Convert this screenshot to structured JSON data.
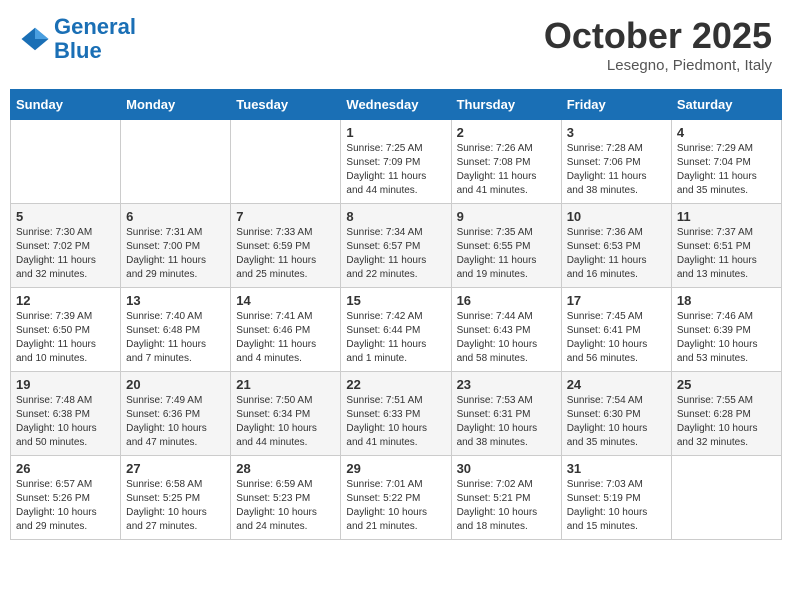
{
  "header": {
    "logo_line1": "General",
    "logo_line2": "Blue",
    "month": "October 2025",
    "location": "Lesegno, Piedmont, Italy"
  },
  "weekdays": [
    "Sunday",
    "Monday",
    "Tuesday",
    "Wednesday",
    "Thursday",
    "Friday",
    "Saturday"
  ],
  "weeks": [
    [
      {
        "day": "",
        "info": ""
      },
      {
        "day": "",
        "info": ""
      },
      {
        "day": "",
        "info": ""
      },
      {
        "day": "1",
        "info": "Sunrise: 7:25 AM\nSunset: 7:09 PM\nDaylight: 11 hours\nand 44 minutes."
      },
      {
        "day": "2",
        "info": "Sunrise: 7:26 AM\nSunset: 7:08 PM\nDaylight: 11 hours\nand 41 minutes."
      },
      {
        "day": "3",
        "info": "Sunrise: 7:28 AM\nSunset: 7:06 PM\nDaylight: 11 hours\nand 38 minutes."
      },
      {
        "day": "4",
        "info": "Sunrise: 7:29 AM\nSunset: 7:04 PM\nDaylight: 11 hours\nand 35 minutes."
      }
    ],
    [
      {
        "day": "5",
        "info": "Sunrise: 7:30 AM\nSunset: 7:02 PM\nDaylight: 11 hours\nand 32 minutes."
      },
      {
        "day": "6",
        "info": "Sunrise: 7:31 AM\nSunset: 7:00 PM\nDaylight: 11 hours\nand 29 minutes."
      },
      {
        "day": "7",
        "info": "Sunrise: 7:33 AM\nSunset: 6:59 PM\nDaylight: 11 hours\nand 25 minutes."
      },
      {
        "day": "8",
        "info": "Sunrise: 7:34 AM\nSunset: 6:57 PM\nDaylight: 11 hours\nand 22 minutes."
      },
      {
        "day": "9",
        "info": "Sunrise: 7:35 AM\nSunset: 6:55 PM\nDaylight: 11 hours\nand 19 minutes."
      },
      {
        "day": "10",
        "info": "Sunrise: 7:36 AM\nSunset: 6:53 PM\nDaylight: 11 hours\nand 16 minutes."
      },
      {
        "day": "11",
        "info": "Sunrise: 7:37 AM\nSunset: 6:51 PM\nDaylight: 11 hours\nand 13 minutes."
      }
    ],
    [
      {
        "day": "12",
        "info": "Sunrise: 7:39 AM\nSunset: 6:50 PM\nDaylight: 11 hours\nand 10 minutes."
      },
      {
        "day": "13",
        "info": "Sunrise: 7:40 AM\nSunset: 6:48 PM\nDaylight: 11 hours\nand 7 minutes."
      },
      {
        "day": "14",
        "info": "Sunrise: 7:41 AM\nSunset: 6:46 PM\nDaylight: 11 hours\nand 4 minutes."
      },
      {
        "day": "15",
        "info": "Sunrise: 7:42 AM\nSunset: 6:44 PM\nDaylight: 11 hours\nand 1 minute."
      },
      {
        "day": "16",
        "info": "Sunrise: 7:44 AM\nSunset: 6:43 PM\nDaylight: 10 hours\nand 58 minutes."
      },
      {
        "day": "17",
        "info": "Sunrise: 7:45 AM\nSunset: 6:41 PM\nDaylight: 10 hours\nand 56 minutes."
      },
      {
        "day": "18",
        "info": "Sunrise: 7:46 AM\nSunset: 6:39 PM\nDaylight: 10 hours\nand 53 minutes."
      }
    ],
    [
      {
        "day": "19",
        "info": "Sunrise: 7:48 AM\nSunset: 6:38 PM\nDaylight: 10 hours\nand 50 minutes."
      },
      {
        "day": "20",
        "info": "Sunrise: 7:49 AM\nSunset: 6:36 PM\nDaylight: 10 hours\nand 47 minutes."
      },
      {
        "day": "21",
        "info": "Sunrise: 7:50 AM\nSunset: 6:34 PM\nDaylight: 10 hours\nand 44 minutes."
      },
      {
        "day": "22",
        "info": "Sunrise: 7:51 AM\nSunset: 6:33 PM\nDaylight: 10 hours\nand 41 minutes."
      },
      {
        "day": "23",
        "info": "Sunrise: 7:53 AM\nSunset: 6:31 PM\nDaylight: 10 hours\nand 38 minutes."
      },
      {
        "day": "24",
        "info": "Sunrise: 7:54 AM\nSunset: 6:30 PM\nDaylight: 10 hours\nand 35 minutes."
      },
      {
        "day": "25",
        "info": "Sunrise: 7:55 AM\nSunset: 6:28 PM\nDaylight: 10 hours\nand 32 minutes."
      }
    ],
    [
      {
        "day": "26",
        "info": "Sunrise: 6:57 AM\nSunset: 5:26 PM\nDaylight: 10 hours\nand 29 minutes."
      },
      {
        "day": "27",
        "info": "Sunrise: 6:58 AM\nSunset: 5:25 PM\nDaylight: 10 hours\nand 27 minutes."
      },
      {
        "day": "28",
        "info": "Sunrise: 6:59 AM\nSunset: 5:23 PM\nDaylight: 10 hours\nand 24 minutes."
      },
      {
        "day": "29",
        "info": "Sunrise: 7:01 AM\nSunset: 5:22 PM\nDaylight: 10 hours\nand 21 minutes."
      },
      {
        "day": "30",
        "info": "Sunrise: 7:02 AM\nSunset: 5:21 PM\nDaylight: 10 hours\nand 18 minutes."
      },
      {
        "day": "31",
        "info": "Sunrise: 7:03 AM\nSunset: 5:19 PM\nDaylight: 10 hours\nand 15 minutes."
      },
      {
        "day": "",
        "info": ""
      }
    ]
  ]
}
